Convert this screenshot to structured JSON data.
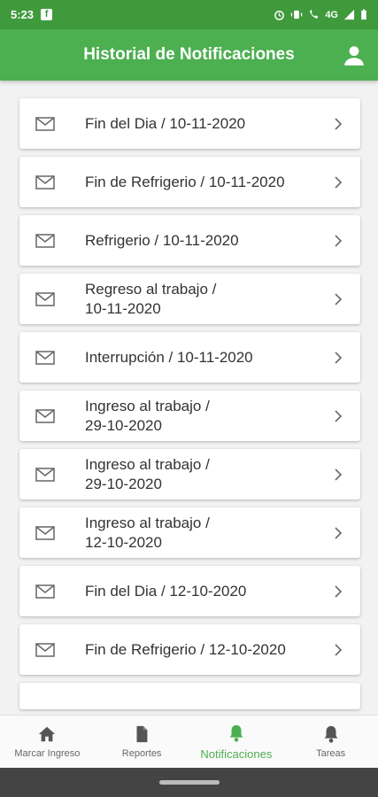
{
  "status_bar": {
    "time": "5:23",
    "network": "4G"
  },
  "header": {
    "title": "Historial de Notificaciones"
  },
  "notifications": [
    {
      "line1": "Fin del Dia / 10-11-2020",
      "line2": ""
    },
    {
      "line1": "Fin de Refrigerio / 10-11-2020",
      "line2": ""
    },
    {
      "line1": "Refrigerio / 10-11-2020",
      "line2": ""
    },
    {
      "line1": "Regreso al trabajo /",
      "line2": "10-11-2020"
    },
    {
      "line1": "Interrupción / 10-11-2020",
      "line2": ""
    },
    {
      "line1": "Ingreso al trabajo /",
      "line2": "29-10-2020"
    },
    {
      "line1": "Ingreso al trabajo /",
      "line2": "29-10-2020"
    },
    {
      "line1": "Ingreso al trabajo /",
      "line2": "12-10-2020"
    },
    {
      "line1": "Fin del Dia / 12-10-2020",
      "line2": ""
    },
    {
      "line1": "Fin de Refrigerio / 12-10-2020",
      "line2": ""
    }
  ],
  "bottom_nav": [
    {
      "label": "Marcar Ingreso",
      "icon": "home-icon",
      "active": false
    },
    {
      "label": "Reportes",
      "icon": "document-icon",
      "active": false
    },
    {
      "label": "Notificaciones",
      "icon": "bell-icon",
      "active": true
    },
    {
      "label": "Tareas",
      "icon": "bell-icon",
      "active": false
    }
  ],
  "colors": {
    "primary": "#4caf50",
    "status_bar": "#3f9a3c",
    "text": "#333333"
  }
}
